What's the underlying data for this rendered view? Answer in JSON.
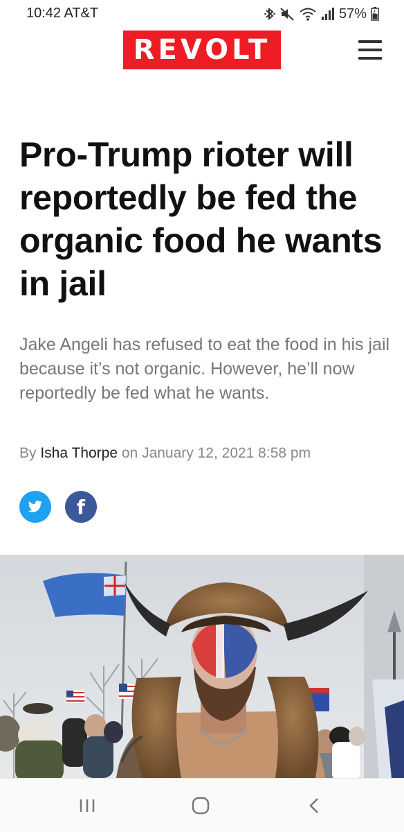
{
  "status_bar": {
    "time": "10:42 AT&T",
    "battery": "57%"
  },
  "header": {
    "logo": "REVOLT"
  },
  "article": {
    "headline": "Pro-Trump rioter will reportedly be fed the organic food he wants in jail",
    "dek": "Jake Angeli has refused to eat the food in his jail because it’s not organic. However, he’ll now reportedly be fed what he wants.",
    "byline_prefix": "By ",
    "author": "Isha Thorpe",
    "byline_mid": " on ",
    "date": "January 12, 2021 8:58 pm"
  },
  "social": {
    "twitter_icon": "twitter-icon",
    "facebook_label": "f"
  },
  "colors": {
    "brand": "#ee1c25",
    "twitter": "#1da1f2",
    "facebook": "#3b5998"
  }
}
